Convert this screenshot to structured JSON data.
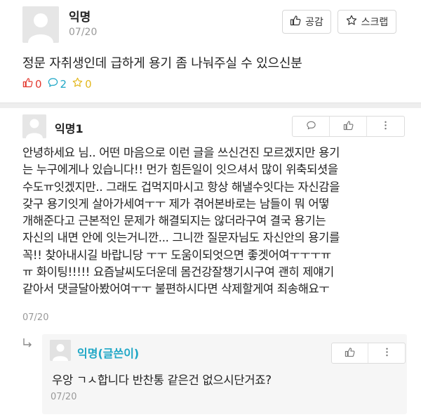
{
  "post": {
    "author": "익명",
    "date": "07/20",
    "like_button_label": "공감",
    "scrap_button_label": "스크랩",
    "body": "정문 자취생인데 급하게 용기 좀 나눠주실 수 있으신분",
    "stats": {
      "likes": "0",
      "comments": "2",
      "scraps": "0"
    }
  },
  "comment": {
    "author": "익명1",
    "lines": [
      "안녕하세요 님.. 어떤 마음으로 이런 글을 쓰신건진 모르겠지만 용기",
      "는 누구에게나 있습니다!! 먼가 힘든일이 잇으셔서 많이 위축되셧을",
      "수도ㅠ잇겠지만.. 그래도 겁먹지마시고 항상 해낼수잇다는 자신감을",
      "갖구 용기잇게 살아가세여ㅜㅜ 제가 겪어본바로는 남들이 뭐 어떻",
      "개해준다고 근본적인 문제가 해결되지는 않더라구여 결국 용기는",
      "자신의 내면 안에 잇는거니깐... 그니깐 질문자님도 자신안의 용기를",
      "꼭!! 찾아내시길 바랍니당 ㅜㅜ 도움이되엇으면 좋겟어여ㅜㅜㅜㅠ",
      "ㅠ 화이팅!!!!! 요즘날씨도더운데 몸건강잘챙기시구여 괜히 제얘기",
      "같아서 댓글달아봤어여ㅜㅜ 불편하시다면 삭제할게여 죄송해요ㅜ"
    ],
    "date": "07/20"
  },
  "reply": {
    "author": "익명(글쓴이)",
    "body": "우앙 ㄱㅅ합니다 반찬통 같은건 없으시단거죠?",
    "date": "07/20"
  },
  "icons": {
    "post_avatar": "user-avatar-icon",
    "like": "thumbs-up-icon",
    "scrap": "star-icon",
    "comment": "speech-bubble-icon",
    "more": "more-vertical-icon",
    "reply_arrow": "reply-arrow-icon"
  },
  "colors": {
    "like_accent": "#e3392f",
    "comment_accent": "#1fa7c6",
    "scrap_accent": "#e3b81f",
    "author_highlight": "#1fa7c6"
  }
}
